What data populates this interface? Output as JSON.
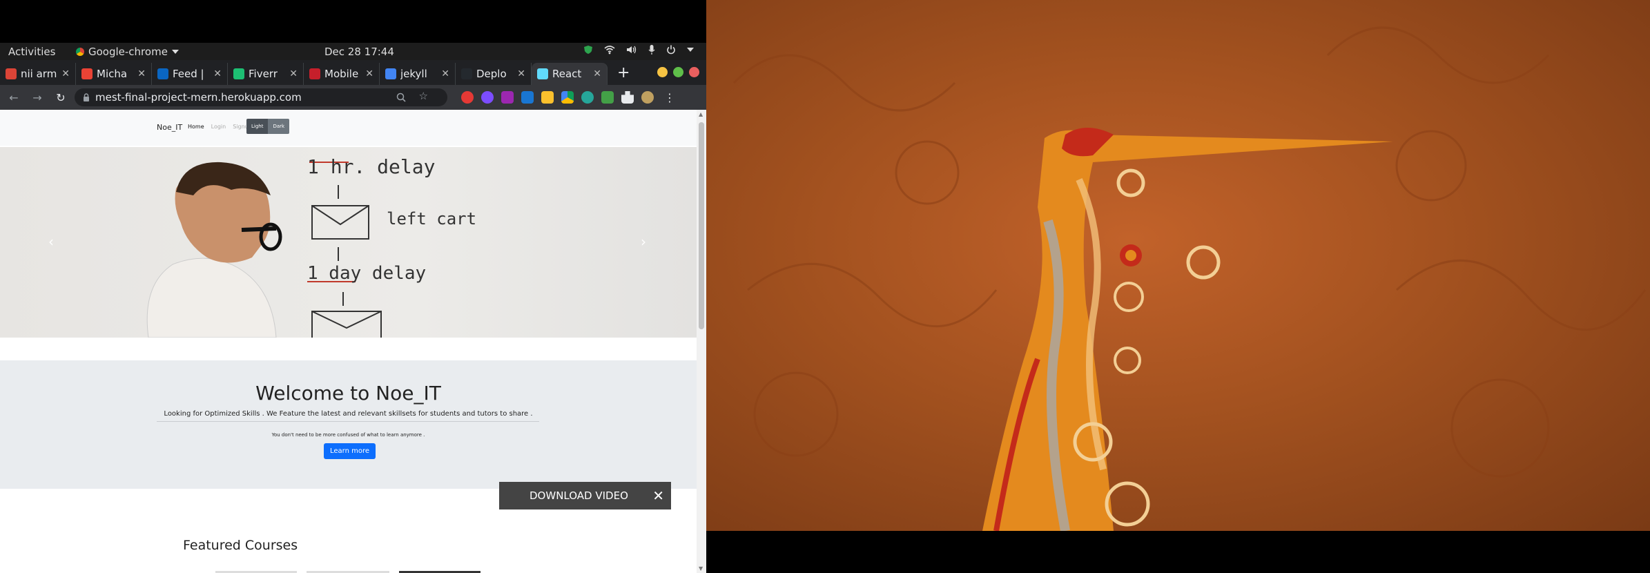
{
  "topbar": {
    "activities": "Activities",
    "app_name": "Google-chrome",
    "clock": "Dec 28  17:44"
  },
  "tabs": [
    {
      "label": "nii arm",
      "color": "#db4437"
    },
    {
      "label": "Micha",
      "color": "#ea4335"
    },
    {
      "label": "Feed |",
      "color": "#0a66c2"
    },
    {
      "label": "Fiverr",
      "color": "#1dbf73"
    },
    {
      "label": "Mobile",
      "color": "#c61f2b"
    },
    {
      "label": "jekyll",
      "color": "#4285f4"
    },
    {
      "label": "Deplo",
      "color": "#24292e"
    },
    {
      "label": "React",
      "color": "#61dafb",
      "active": true
    }
  ],
  "toolbar": {
    "url": "mest-final-project-mern.herokuapp.com"
  },
  "site": {
    "brand": "Noe_IT",
    "nav": {
      "home": "Home",
      "login": "Login",
      "signup": "Signup",
      "light": "Light",
      "dark": "Dark"
    },
    "whiteboard": {
      "line1": "1 hr. delay",
      "line2": "left cart",
      "line3": "1 day delay"
    },
    "jumbotron": {
      "title": "Welcome to Noe_IT",
      "lead": "Looking for Optimized Skills . We Feature the latest and relevant skillsets for students and tutors to share .",
      "small": "You don't need to be more confused of what to learn anymore .",
      "button": "Learn more"
    },
    "featured_title": "Featured Courses"
  },
  "overlay": {
    "download_video": "DOWNLOAD VIDEO"
  }
}
